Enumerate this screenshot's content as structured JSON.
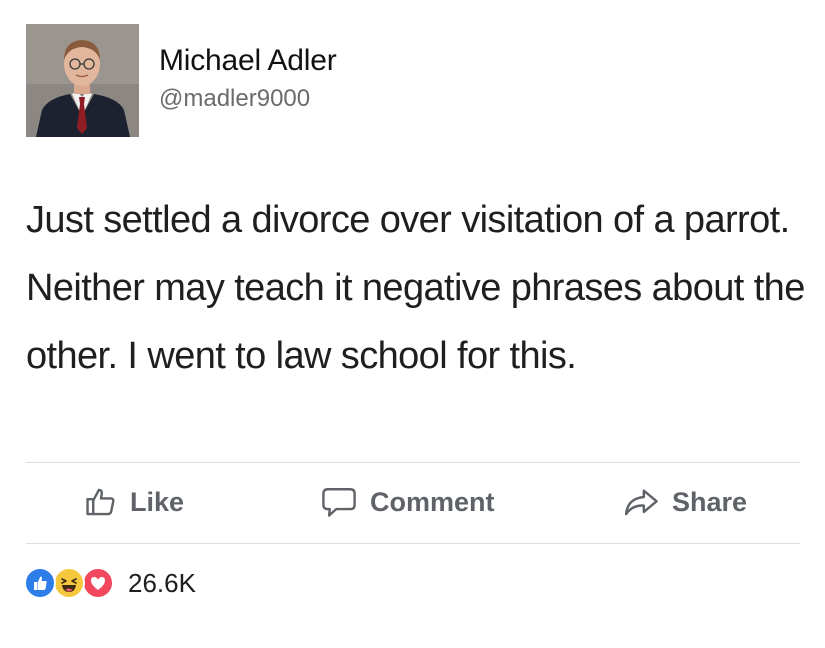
{
  "author": {
    "name": "Michael Adler",
    "handle": "@madler9000"
  },
  "post": {
    "text": "Just settled a divorce over visitation of a parrot. Neither may teach it negative phrases about the other. I went to law school for this."
  },
  "actions": {
    "like_label": "Like",
    "comment_label": "Comment",
    "share_label": "Share"
  },
  "reactions": {
    "icons": [
      "like-reaction-icon",
      "haha-reaction-icon",
      "love-reaction-icon"
    ],
    "count": "26.6K"
  },
  "colors": {
    "like_blue": "#2d7ee8",
    "haha_yellow": "#f6c83e",
    "love_red": "#f2475c",
    "action_gray": "#5f6368"
  }
}
